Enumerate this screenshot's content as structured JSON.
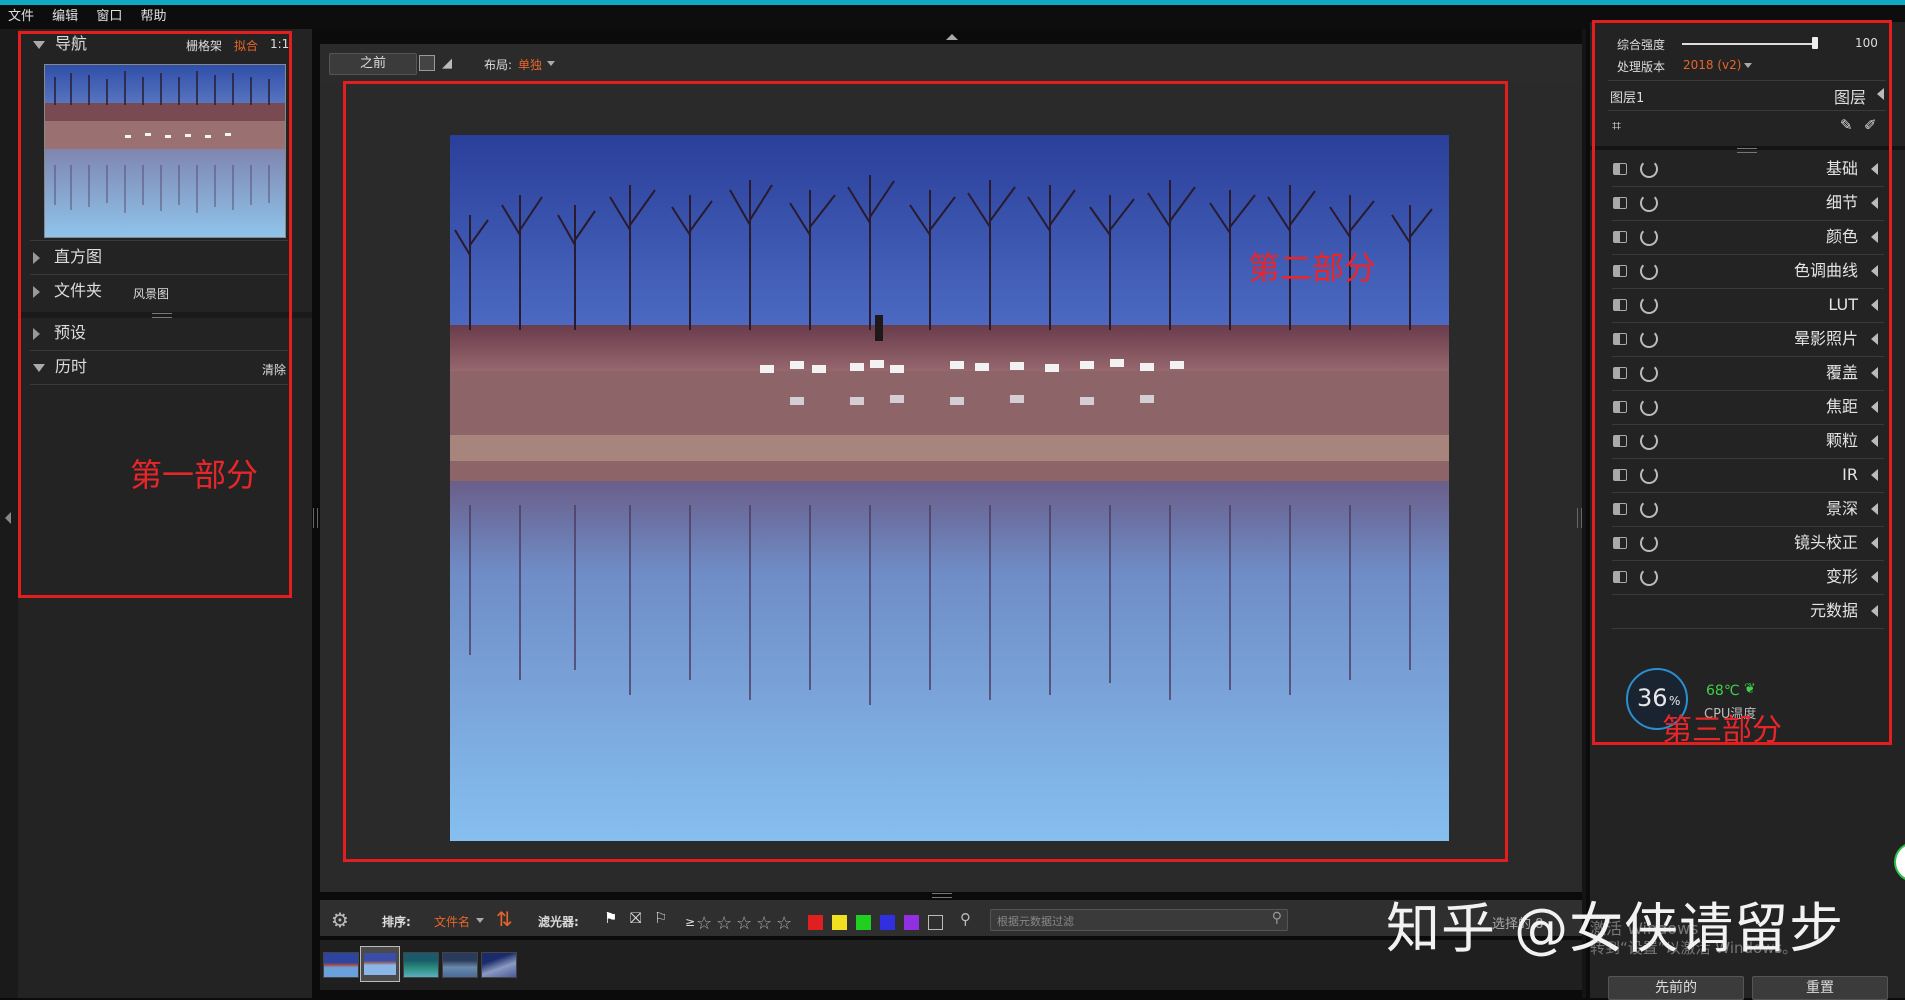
{
  "menu": [
    "文件",
    "编辑",
    "窗口",
    "帮助"
  ],
  "left_panel": {
    "nav_title": "导航",
    "nav_options": {
      "grid": "栅格架",
      "fit": "拟合",
      "ratio": "1:1"
    },
    "histogram": "直方图",
    "folder": "文件夹",
    "folder_value": "风景图",
    "presets": "预设",
    "history": "历时",
    "history_clear": "清除",
    "annotation": "第一部分"
  },
  "toolbar": {
    "before_button": "之前",
    "layout_label": "布局:",
    "layout_value": "单独"
  },
  "canvas": {
    "annotation": "第二部分"
  },
  "bottom_bar": {
    "sort_label": "排序:",
    "sort_value": "文件名",
    "filter_label": "滤光器:",
    "rating_prefix": "≥",
    "stars": 5,
    "search_placeholder": "根据元数据过滤",
    "selected_text": "选择的 8",
    "colors": [
      "#e02020",
      "#f0e020",
      "#20d020",
      "#3030e0",
      "#9030e0"
    ]
  },
  "right_panel": {
    "strength_label": "综合强度",
    "strength_value": "100",
    "strength_level": 1.0,
    "version_label": "处理版本",
    "version_value": "2018 (v2)",
    "layer_name": "图层1",
    "layers_label": "图层",
    "sections": [
      "基础",
      "细节",
      "颜色",
      "色调曲线",
      "LUT",
      "晕影照片",
      "覆盖",
      "焦距",
      "颗粒",
      "IR",
      "景深",
      "镜头校正",
      "变形",
      "元数据"
    ],
    "annotation": "第三部分",
    "prev_button": "先前的",
    "reset_button": "重置"
  },
  "cpu_widget": {
    "percent": "36",
    "percent_unit": "%",
    "temp": "68℃",
    "label": "CPU温度"
  },
  "watermark": {
    "brand": "知乎 @女侠请留步",
    "windows_line1": "激活 Windows",
    "windows_line2": "转到“设置”以激活 Windows。"
  }
}
